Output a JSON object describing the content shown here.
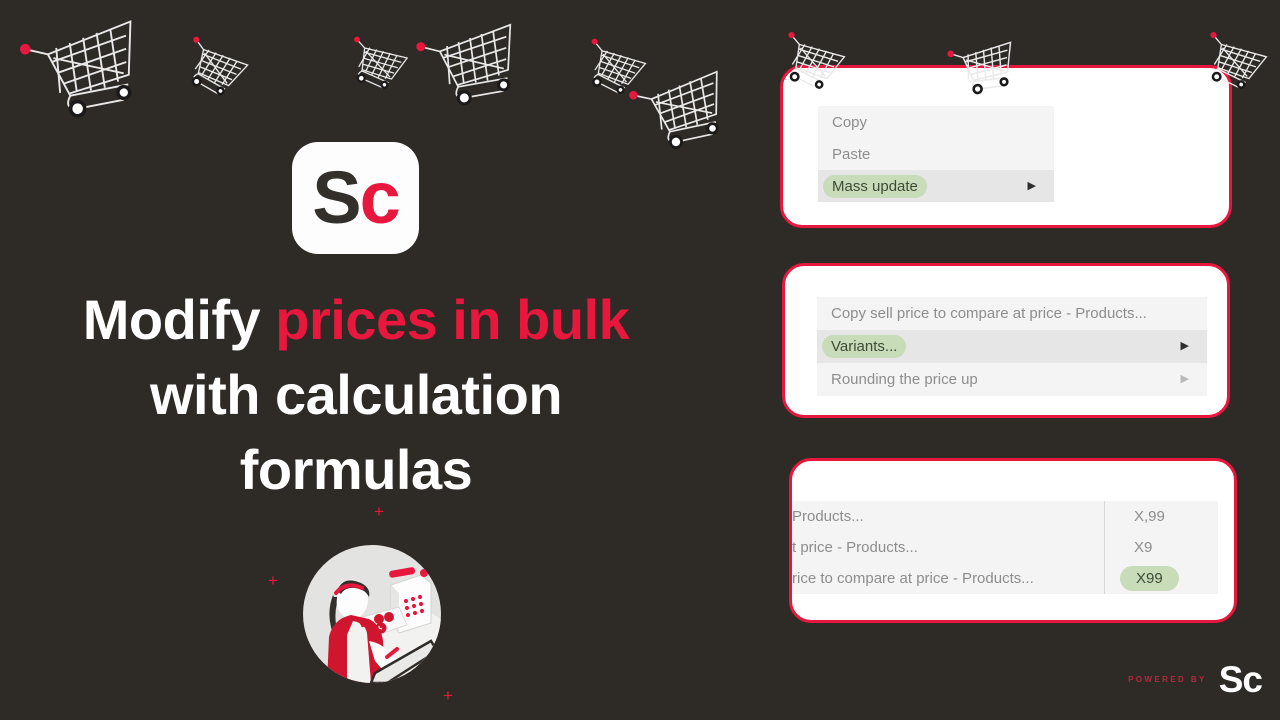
{
  "background_color": "#2e2a26",
  "accent_red": "#e8173d",
  "highlight_green": "#c8dcb9",
  "logo": {
    "letters_dark": "S",
    "letters_red": "c",
    "name": "sc-app-logo"
  },
  "headline": {
    "line1_plain": "Modify ",
    "line1_accent": "prices in bulk",
    "line2": "with calculation",
    "line3": "formulas"
  },
  "illustration": {
    "name": "cashier-illustration",
    "plus_marks": [
      "+",
      "+",
      "+"
    ]
  },
  "panels": [
    {
      "name": "context-menu-panel",
      "rows": [
        {
          "label": "Copy",
          "highlighted": false,
          "arrow": false
        },
        {
          "label": "Paste",
          "highlighted": false,
          "arrow": false
        },
        {
          "label": "Mass update",
          "highlighted": true,
          "arrow": true
        }
      ]
    },
    {
      "name": "mass-update-submenu-panel",
      "rows": [
        {
          "label": "Copy sell price to compare at price - Products...",
          "highlighted": false,
          "arrow": false
        },
        {
          "label": "Variants...",
          "highlighted": true,
          "arrow": true
        },
        {
          "label": "Rounding the price up",
          "highlighted": false,
          "arrow": true
        }
      ]
    },
    {
      "name": "rounding-options-panel",
      "left_rows": [
        "Products...",
        "t price - Products...",
        "rice to compare at price - Products..."
      ],
      "right_rows": [
        {
          "label": "X,99",
          "highlighted": false
        },
        {
          "label": "X9",
          "highlighted": false
        },
        {
          "label": "X99",
          "highlighted": true
        }
      ]
    }
  ],
  "footer": {
    "powered_by": "POWERED BY",
    "wordmark_s": "S",
    "wordmark_c": "c"
  },
  "carts": [
    {
      "name": "cart-doodle-1"
    },
    {
      "name": "cart-doodle-2"
    },
    {
      "name": "cart-doodle-3"
    },
    {
      "name": "cart-doodle-4"
    },
    {
      "name": "cart-doodle-5"
    },
    {
      "name": "cart-doodle-6"
    },
    {
      "name": "cart-doodle-7"
    },
    {
      "name": "cart-doodle-8"
    },
    {
      "name": "cart-doodle-9"
    }
  ]
}
